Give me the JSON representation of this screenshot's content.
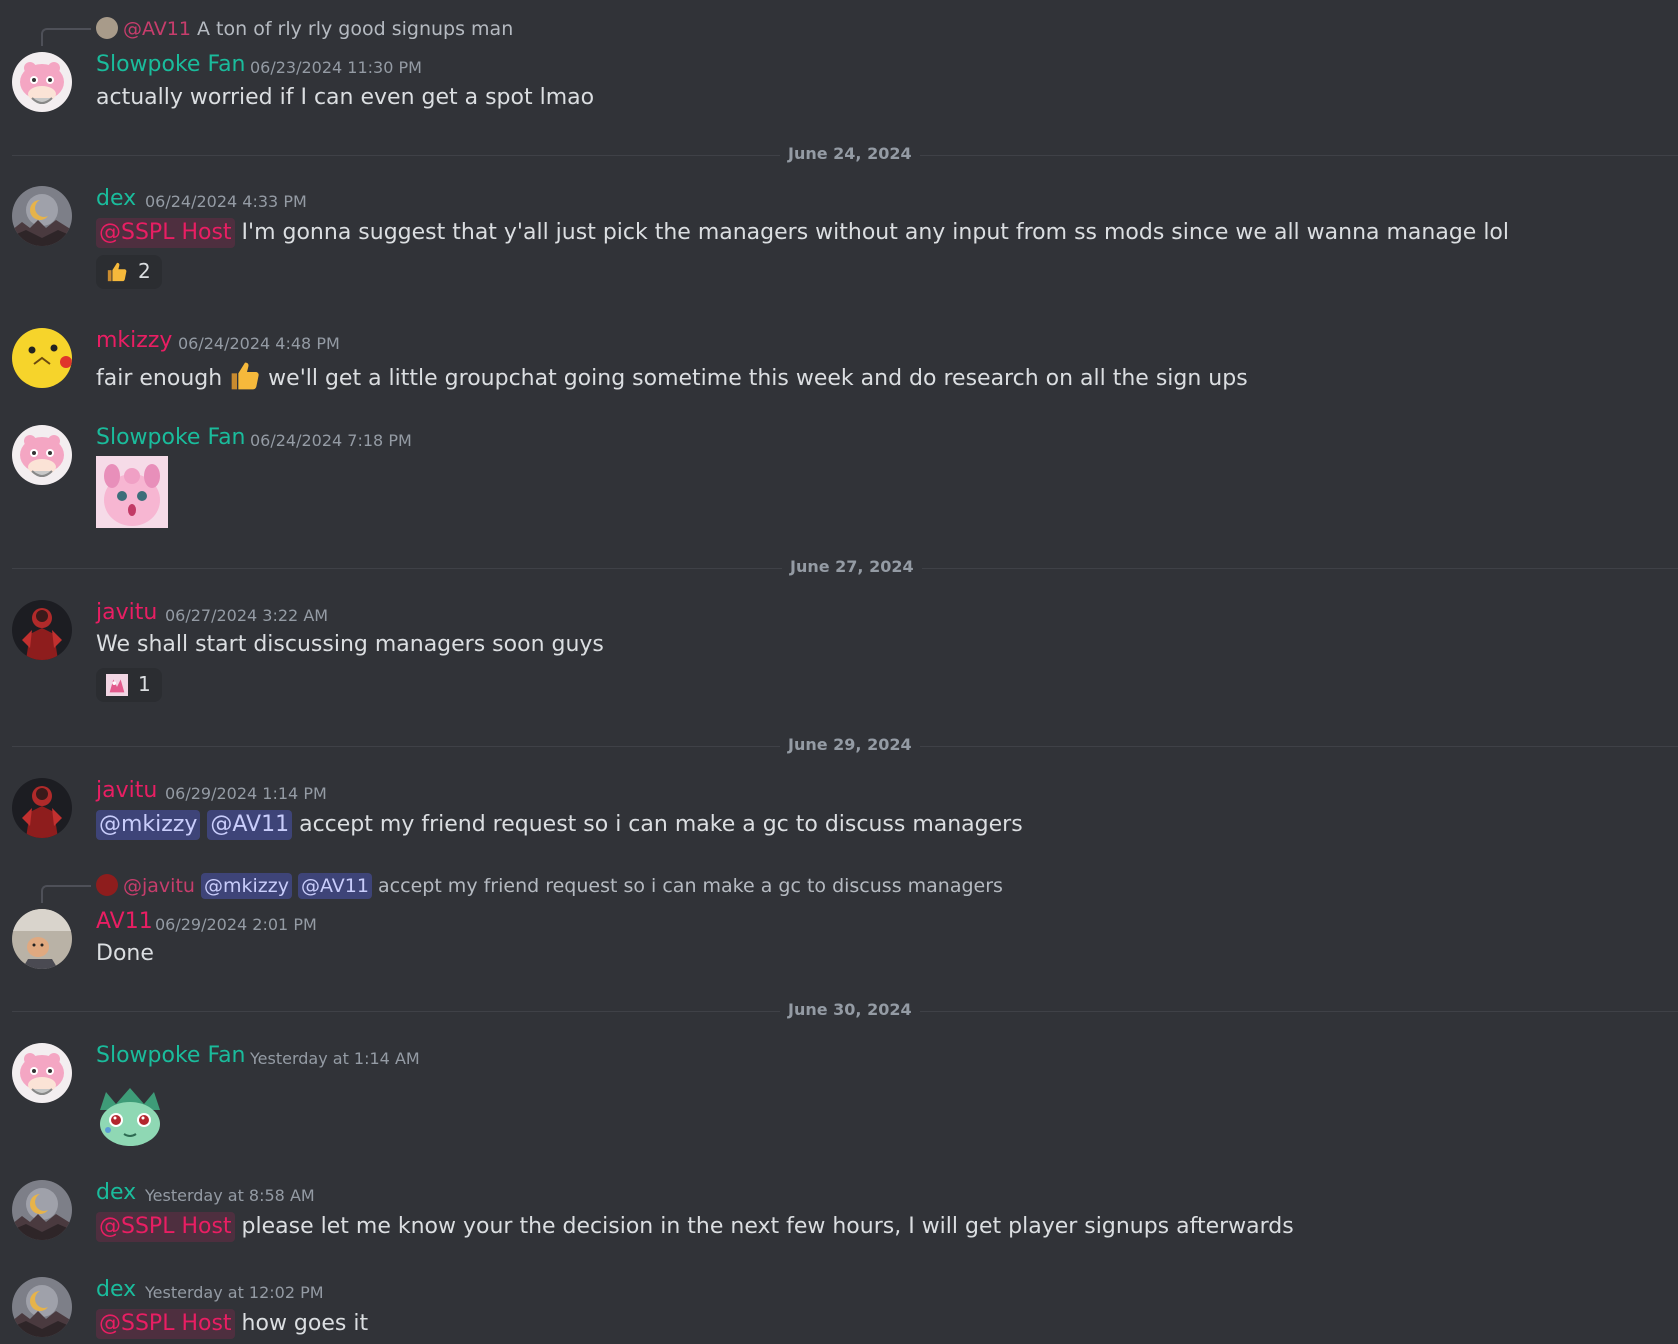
{
  "colors": {
    "background": "#313338",
    "teal_name": "#1abc9c",
    "pink_name": "#e91e63",
    "timestamp": "#949ba4",
    "text": "#dbdee1",
    "user_mention_bg": "#5865f2"
  },
  "messages": [
    {
      "reply": {
        "author": "@AV11",
        "text": "A ton of rly rly good signups man"
      },
      "author": "Slowpoke Fan",
      "timestamp": "06/23/2024 11:30 PM",
      "avatar": "slowpoke-avatar",
      "text": "actually worried if I can even get a spot lmao"
    },
    {
      "divider": "June 24, 2024"
    },
    {
      "author": "dex",
      "timestamp": "06/24/2024 4:33 PM",
      "avatar": "moon-avatar",
      "mention": "@SSPL Host",
      "text": "I'm gonna suggest that y'all just pick the managers without any input from ss mods since we all wanna manage lol",
      "reaction": {
        "emoji": "thumbs-up-icon",
        "count": "2"
      }
    },
    {
      "author": "mkizzy",
      "timestamp": "06/24/2024 4:48 PM",
      "avatar": "pikachu-avatar",
      "text_before": "fair enough",
      "inline_emoji": "thumbs-up-icon",
      "text_after": "we'll get a little groupchat going sometime this week and do research on all the sign ups"
    },
    {
      "author": "Slowpoke Fan",
      "timestamp": "06/24/2024 7:18 PM",
      "avatar": "slowpoke-avatar",
      "sticker": "wigglytuff-sticker"
    },
    {
      "divider": "June 27, 2024"
    },
    {
      "author": "javitu",
      "timestamp": "06/27/2024 3:22 AM",
      "avatar": "red-figure-avatar",
      "text": "We shall start discussing managers soon guys",
      "reaction": {
        "emoji": "pink-emote-icon",
        "count": "1"
      }
    },
    {
      "divider": "June 29, 2024"
    },
    {
      "author": "javitu",
      "timestamp": "06/29/2024 1:14 PM",
      "avatar": "red-figure-avatar",
      "mentions": [
        "@mkizzy",
        "@AV11"
      ],
      "text": "accept my friend request so i can make a gc to discuss managers"
    },
    {
      "reply": {
        "author": "@javitu",
        "mentions": [
          "@mkizzy",
          "@AV11"
        ],
        "text": "accept my friend request so i can make a gc to discuss managers"
      },
      "author": "AV11",
      "timestamp": "06/29/2024 2:01 PM",
      "avatar": "photo-avatar",
      "text": "Done"
    },
    {
      "divider": "June 30, 2024"
    },
    {
      "author": "Slowpoke Fan",
      "timestamp": "Yesterday at 1:14 AM",
      "avatar": "slowpoke-avatar",
      "sticker": "bulbasaur-sticker"
    },
    {
      "author": "dex",
      "timestamp": "Yesterday at 8:58 AM",
      "avatar": "moon-avatar",
      "mention": "@SSPL Host",
      "text": "please let me know your the decision in the next few hours, I will get player signups afterwards"
    },
    {
      "author": "dex",
      "timestamp": "Yesterday at 12:02 PM",
      "avatar": "moon-avatar",
      "mention": "@SSPL Host",
      "text": "how goes it"
    }
  ]
}
